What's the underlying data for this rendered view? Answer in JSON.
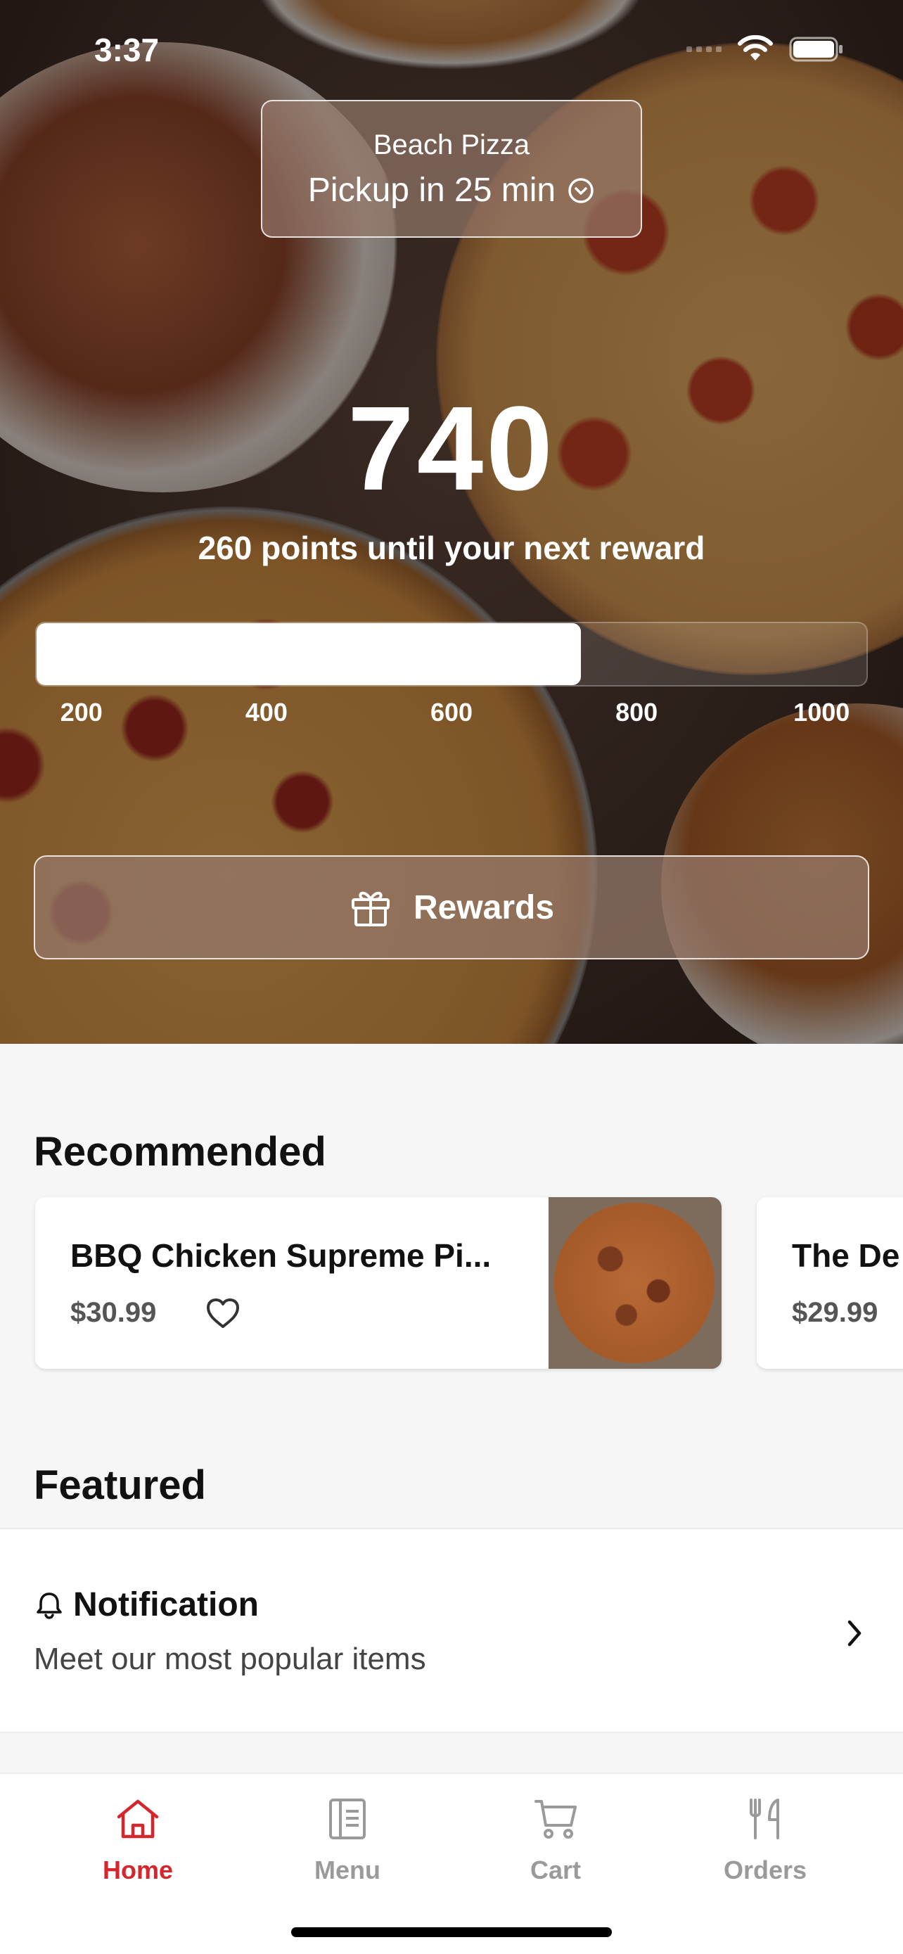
{
  "status_bar": {
    "time": "3:37"
  },
  "store": {
    "name": "Beach Pizza",
    "pickup": "Pickup in 25 min"
  },
  "rewards_progress": {
    "points": "740",
    "caption": "260 points until your next reward",
    "current": 740,
    "scale_min": 150,
    "scale_max": 1050,
    "ticks": [
      "200",
      "400",
      "600",
      "800",
      "1000"
    ],
    "button_label": "Rewards"
  },
  "recommended": {
    "title": "Recommended",
    "items": [
      {
        "name": "BBQ Chicken Supreme Pi...",
        "price": "$30.99"
      },
      {
        "name": "The De",
        "price": "$29.99"
      }
    ]
  },
  "featured": {
    "title": "Featured",
    "notification": {
      "title": "Notification",
      "subtitle": "Meet our most popular items"
    }
  },
  "tabs": [
    {
      "label": "Home",
      "icon": "home-icon",
      "active": true
    },
    {
      "label": "Menu",
      "icon": "menu-icon",
      "active": false
    },
    {
      "label": "Cart",
      "icon": "cart-icon",
      "active": false
    },
    {
      "label": "Orders",
      "icon": "utensils-icon",
      "active": false
    }
  ],
  "colors": {
    "accent": "#d4262c",
    "inactive_tab": "#9a9a9a"
  }
}
